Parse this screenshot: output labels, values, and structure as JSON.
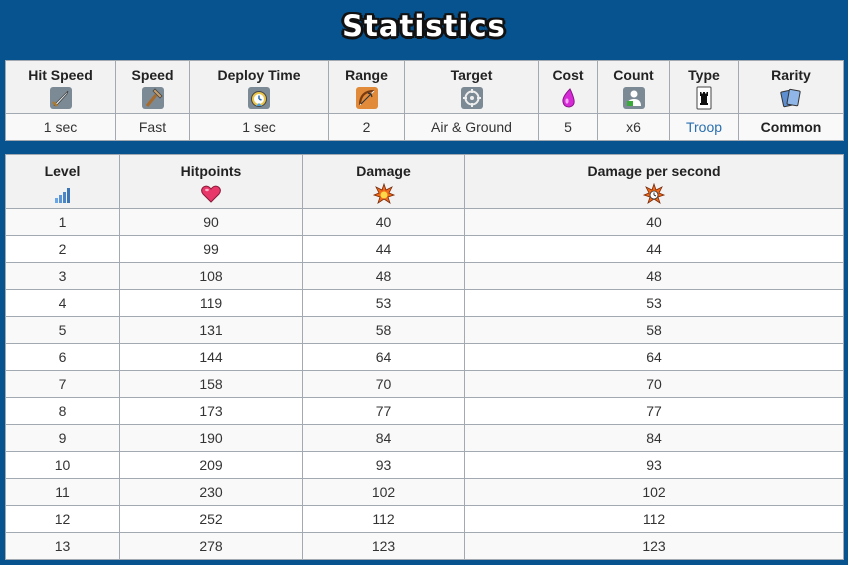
{
  "title": "Statistics",
  "stats": {
    "headers": [
      "Hit Speed",
      "Speed",
      "Deploy Time",
      "Range",
      "Target",
      "Cost",
      "Count",
      "Type",
      "Rarity"
    ],
    "values": [
      "1 sec",
      "Fast",
      "1 sec",
      "2",
      "Air & Ground",
      "5",
      "x6",
      "Troop",
      "Common"
    ],
    "icons": [
      "sword-icon",
      "hammer-icon",
      "stopwatch-icon",
      "bow-icon",
      "crosshair-icon",
      "elixir-drop-icon",
      "person-icon",
      "tower-icon",
      "cards-icon"
    ]
  },
  "levels": {
    "headers": [
      "Level",
      "Hitpoints",
      "Damage",
      "Damage per second"
    ],
    "icons": [
      "signal-bars-icon",
      "heart-icon",
      "explosion-icon",
      "explosion-clock-icon"
    ],
    "rows": [
      [
        "1",
        "90",
        "40",
        "40"
      ],
      [
        "2",
        "99",
        "44",
        "44"
      ],
      [
        "3",
        "108",
        "48",
        "48"
      ],
      [
        "4",
        "119",
        "53",
        "53"
      ],
      [
        "5",
        "131",
        "58",
        "58"
      ],
      [
        "6",
        "144",
        "64",
        "64"
      ],
      [
        "7",
        "158",
        "70",
        "70"
      ],
      [
        "8",
        "173",
        "77",
        "77"
      ],
      [
        "9",
        "190",
        "84",
        "84"
      ],
      [
        "10",
        "209",
        "93",
        "93"
      ],
      [
        "11",
        "230",
        "102",
        "102"
      ],
      [
        "12",
        "252",
        "112",
        "112"
      ],
      [
        "13",
        "278",
        "123",
        "123"
      ]
    ]
  },
  "colors": {
    "background": "#06538f",
    "link": "#2a6fb0",
    "border": "#a2a9b1"
  }
}
